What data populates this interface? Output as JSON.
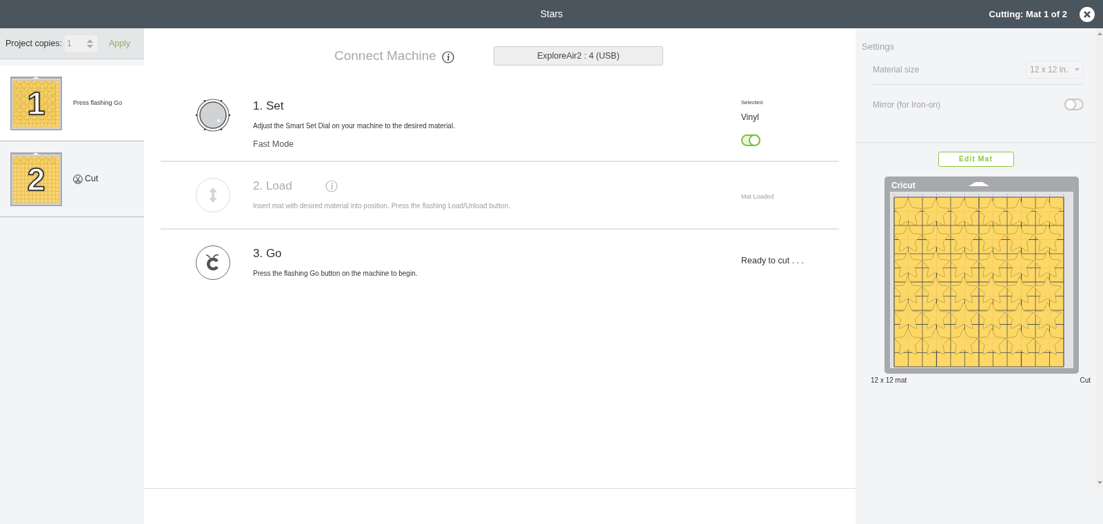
{
  "header": {
    "title": "Stars",
    "status": "Cutting: Mat 1 of 2"
  },
  "sidebar": {
    "copies_label": "Project copies:",
    "copies_value": "1",
    "apply": "Apply",
    "apply_disabled": true,
    "mats": [
      {
        "number": "1",
        "label": "Press flashing Go",
        "selected": true,
        "kind": "status"
      },
      {
        "number": "2",
        "label": "Cut",
        "selected": false,
        "kind": "cut"
      }
    ]
  },
  "connect": {
    "title": "Connect Machine",
    "machine": "ExploreAir2 : 4 (USB)"
  },
  "steps": [
    {
      "kind": "dial",
      "title": "1. Set",
      "description": "Adjust the Smart Set Dial on your machine to the desired material.",
      "disabled": false,
      "info": false,
      "status_label": "Selected",
      "status": "Vinyl",
      "option": "Fast Mode",
      "option_on": true
    },
    {
      "kind": "load",
      "title": "2. Load",
      "description": "Insert mat with desired material into position. Press the flashing Load/Unload button.",
      "disabled": true,
      "info": true,
      "status": "Mat Loaded"
    },
    {
      "kind": "go",
      "title": "3. Go",
      "description": "Press the flashing Go button on the machine to begin.",
      "disabled": false,
      "info": false,
      "status": "Ready to cut . . ."
    }
  ],
  "settings": {
    "title": "Settings",
    "material_label": "Material size",
    "material_value": "12 x 12 in.",
    "mirror_label": "Mirror (for Iron-on)",
    "mirror_on": false,
    "edit_mat": "Edit Mat"
  },
  "mat": {
    "logo": "Cricut",
    "size_label": "12 x 12 mat",
    "mode_label": "Cut"
  }
}
